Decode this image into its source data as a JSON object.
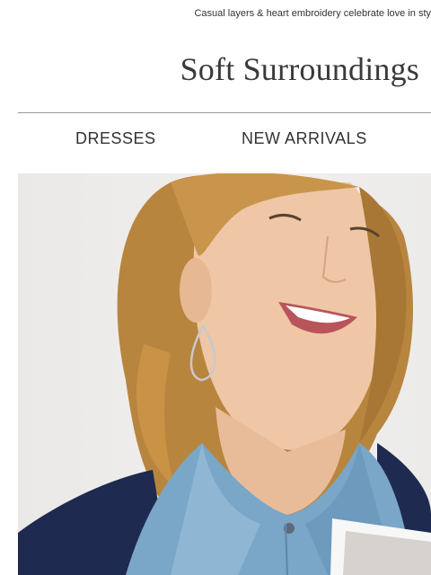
{
  "preheader": {
    "text": "Casual layers & heart embroidery celebrate love in sty"
  },
  "brand": {
    "logo_text": "Soft Surroundings"
  },
  "nav": {
    "items": [
      {
        "label": "DRESSES"
      },
      {
        "label": "NEW ARRIVALS"
      }
    ]
  },
  "hero": {
    "image": "smiling-woman-denim-shirt-earrings",
    "colors": {
      "background": "#ecebe9",
      "hair": "#b8853f",
      "skin": "#efc7a6",
      "denim": "#7aa6c8",
      "navy": "#1e2a4f"
    }
  }
}
